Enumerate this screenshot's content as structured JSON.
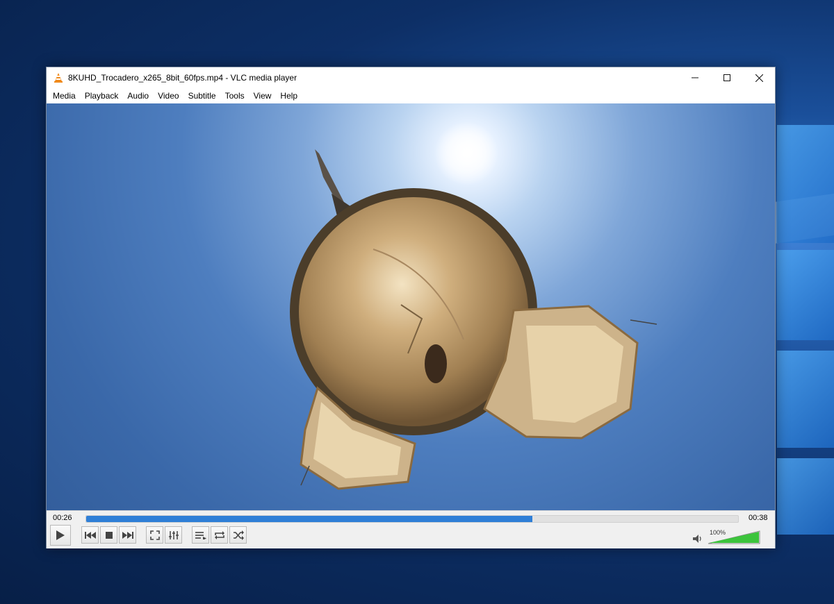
{
  "window": {
    "title": "8KUHD_Trocadero_x265_8bit_60fps.mp4 - VLC media player",
    "controls": [
      "minimize",
      "maximize",
      "close"
    ]
  },
  "menu": {
    "items": [
      "Media",
      "Playback",
      "Audio",
      "Video",
      "Subtitle",
      "Tools",
      "View",
      "Help"
    ]
  },
  "player": {
    "elapsed": "00:26",
    "duration": "00:38",
    "progress_fraction": 0.684,
    "volume_label": "100%",
    "volume_fraction": 1.0
  },
  "colors": {
    "accent": "#2f7fd7",
    "volume": "#3cc43c"
  },
  "icons": {
    "play": "play-icon",
    "prev": "previous-icon",
    "stop": "stop-icon",
    "next": "next-icon",
    "fullscreen": "fullscreen-icon",
    "extended": "extended-settings-icon",
    "playlist": "playlist-icon",
    "loop": "loop-icon",
    "random": "shuffle-icon",
    "volume": "speaker-icon"
  }
}
